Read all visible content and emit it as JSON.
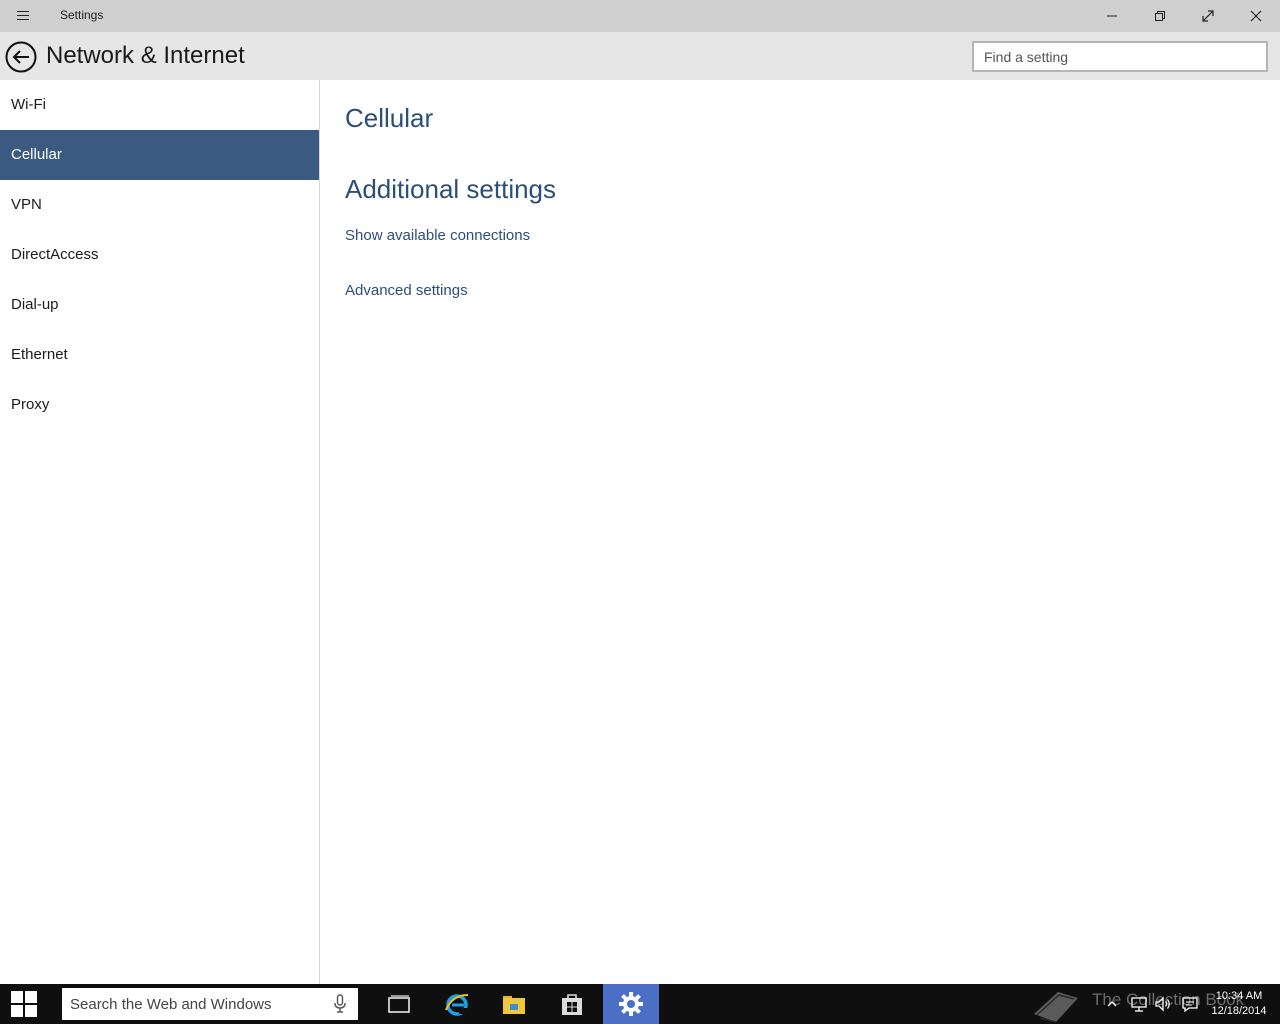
{
  "window": {
    "title": "Settings",
    "controls": {
      "minimize": "minimize-icon",
      "restore": "restore-icon",
      "fullscreen": "fullscreen-icon",
      "close": "close-icon"
    }
  },
  "header": {
    "title": "Network & Internet",
    "search_placeholder": "Find a setting"
  },
  "sidebar": {
    "items": [
      {
        "label": "Wi-Fi",
        "selected": false
      },
      {
        "label": "Cellular",
        "selected": true
      },
      {
        "label": "VPN",
        "selected": false
      },
      {
        "label": "DirectAccess",
        "selected": false
      },
      {
        "label": "Dial-up",
        "selected": false
      },
      {
        "label": "Ethernet",
        "selected": false
      },
      {
        "label": "Proxy",
        "selected": false
      }
    ]
  },
  "content": {
    "section_title": "Cellular",
    "additional_title": "Additional settings",
    "links": [
      "Show available connections",
      "Advanced settings"
    ]
  },
  "taskbar": {
    "search_placeholder": "Search the Web and Windows",
    "watermark": "The Collection Book",
    "clock": {
      "time": "10:34 AM",
      "date": "12/18/2014"
    }
  },
  "colors": {
    "accent": "#3b5a80",
    "link": "#2b4f77",
    "titlebar": "#cfcfcf",
    "header": "#e6e6e6",
    "taskbar": "#0f0f0f",
    "active_app": "#4a6fc4"
  }
}
